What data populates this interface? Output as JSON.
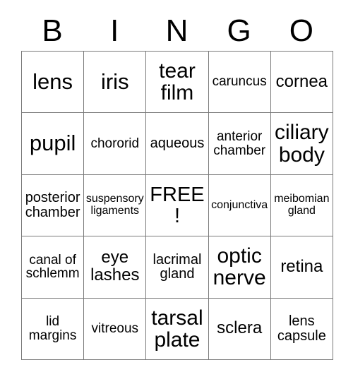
{
  "card": {
    "headers": [
      "B",
      "I",
      "N",
      "G",
      "O"
    ],
    "rows": [
      [
        {
          "label": "lens",
          "size": "fs-xl"
        },
        {
          "label": "iris",
          "size": "fs-xl"
        },
        {
          "label": "tear film",
          "size": "fs-lg"
        },
        {
          "label": "caruncus",
          "size": "fs-xs"
        },
        {
          "label": "cornea",
          "size": "fs-md"
        }
      ],
      [
        {
          "label": "pupil",
          "size": "fs-xl"
        },
        {
          "label": "chororid",
          "size": "fs-xs"
        },
        {
          "label": "aqueous",
          "size": "fs-sm"
        },
        {
          "label": "anterior chamber",
          "size": "fs-xs"
        },
        {
          "label": "ciliary body",
          "size": "fs-lg"
        }
      ],
      [
        {
          "label": "posterior chamber",
          "size": "fs-sm"
        },
        {
          "label": "suspensory ligaments",
          "size": "fs-xxs"
        },
        {
          "label": "FREE!",
          "size": "fs-free"
        },
        {
          "label": "conjunctiva",
          "size": "fs-xxs"
        },
        {
          "label": "meibomian gland",
          "size": "fs-xxs"
        }
      ],
      [
        {
          "label": "canal of schlemm",
          "size": "fs-xs"
        },
        {
          "label": "eye lashes",
          "size": "fs-md"
        },
        {
          "label": "lacrimal gland",
          "size": "fs-sm"
        },
        {
          "label": "optic nerve",
          "size": "fs-lg"
        },
        {
          "label": "retina",
          "size": "fs-md"
        }
      ],
      [
        {
          "label": "lid margins",
          "size": "fs-xs"
        },
        {
          "label": "vitreous",
          "size": "fs-xs"
        },
        {
          "label": "tarsal plate",
          "size": "fs-lg"
        },
        {
          "label": "sclera",
          "size": "fs-md"
        },
        {
          "label": "lens capsule",
          "size": "fs-sm"
        }
      ]
    ]
  },
  "colors": {
    "border": "#7a7a7a",
    "text": "#000000",
    "background": "#ffffff"
  }
}
